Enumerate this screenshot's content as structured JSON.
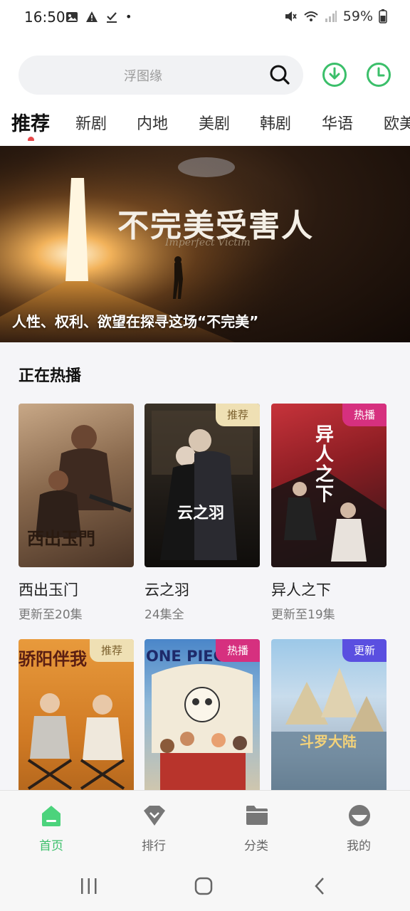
{
  "status": {
    "time": "16:50",
    "dot": "•",
    "battery": "59%"
  },
  "search": {
    "placeholder": "浮图缘"
  },
  "tabs": [
    {
      "label": "推荐",
      "active": true
    },
    {
      "label": "新剧"
    },
    {
      "label": "内地"
    },
    {
      "label": "美剧"
    },
    {
      "label": "韩剧"
    },
    {
      "label": "华语"
    },
    {
      "label": "欧美"
    }
  ],
  "banner": {
    "title": "不完美受害人",
    "subtitle": "Imperfect Victim",
    "caption": "人性、权利、欲望在探寻这场“不完美”"
  },
  "section": {
    "title": "正在热播"
  },
  "cards": [
    {
      "title": "西出玉门",
      "sub": "更新至20集",
      "poster_text": "西出玉門",
      "badge": ""
    },
    {
      "title": "云之羽",
      "sub": "24集全",
      "poster_text": "云之羽",
      "badge": "推荐"
    },
    {
      "title": "异人之下",
      "sub": "更新至19集",
      "poster_text": "异人之下",
      "badge": "热播"
    },
    {
      "title": "",
      "sub": "",
      "poster_text": "骄阳伴我",
      "badge": "推荐"
    },
    {
      "title": "",
      "sub": "",
      "poster_text": "ONE PIECE",
      "badge": "热播"
    },
    {
      "title": "",
      "sub": "",
      "poster_text": "斗罗大陆",
      "badge": "更新"
    }
  ],
  "bottom_nav": [
    {
      "label": "首页",
      "icon": "home-icon",
      "active": true
    },
    {
      "label": "排行",
      "icon": "ranking-icon"
    },
    {
      "label": "分类",
      "icon": "folder-icon"
    },
    {
      "label": "我的",
      "icon": "profile-icon"
    }
  ],
  "colors": {
    "accent": "#3bbf6a",
    "tab_dot": "#e8484a",
    "badge_recommend": "#efe0b4",
    "badge_hot": "#d6307f",
    "badge_new": "#5a4fe0"
  }
}
